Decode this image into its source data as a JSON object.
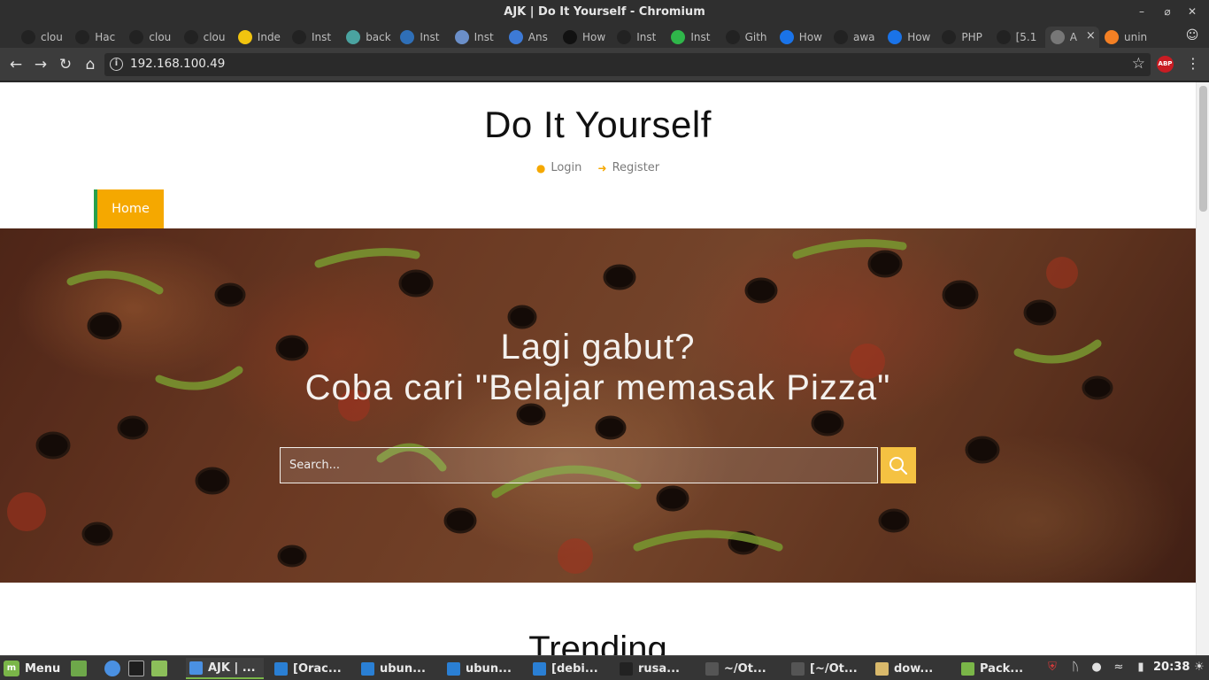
{
  "window": {
    "title": "AJK | Do It Yourself - Chromium"
  },
  "tabs": [
    {
      "label": "clou",
      "icon": "github-icon",
      "color": "#222222"
    },
    {
      "label": "Hac",
      "icon": "github-icon",
      "color": "#222222"
    },
    {
      "label": "clou",
      "icon": "github-icon",
      "color": "#222222"
    },
    {
      "label": "clou",
      "icon": "github-icon",
      "color": "#222222"
    },
    {
      "label": "Inde",
      "icon": "lp-icon",
      "color": "#f1c40f"
    },
    {
      "label": "Inst",
      "icon": "github-icon",
      "color": "#222222"
    },
    {
      "label": "back",
      "icon": "shield-icon",
      "color": "#4aa3a0"
    },
    {
      "label": "Inst",
      "icon": "cr-icon",
      "color": "#2f6fb7"
    },
    {
      "label": "Inst",
      "icon": "network-icon",
      "color": "#6b8fc9"
    },
    {
      "label": "Ans",
      "icon": "askubuntu-icon",
      "color": "#3d7ad6"
    },
    {
      "label": "How",
      "icon": "medium-icon",
      "color": "#111111"
    },
    {
      "label": "Inst",
      "icon": "github-icon",
      "color": "#222222"
    },
    {
      "label": "Inst",
      "icon": "cube-icon",
      "color": "#2fb64a"
    },
    {
      "label": "Gith",
      "icon": "github-icon",
      "color": "#222222"
    },
    {
      "label": "How",
      "icon": "digitalocean-icon",
      "color": "#1a73e8"
    },
    {
      "label": "awa",
      "icon": "github-icon",
      "color": "#222222"
    },
    {
      "label": "How",
      "icon": "digitalocean-icon",
      "color": "#1a73e8"
    },
    {
      "label": "PHP",
      "icon": "github-icon",
      "color": "#222222"
    },
    {
      "label": "[5.1",
      "icon": "github-icon",
      "color": "#222222"
    },
    {
      "label": "A",
      "icon": "page-icon",
      "color": "#777777",
      "active": true
    },
    {
      "label": "unin",
      "icon": "stackoverflow-icon",
      "color": "#f48024"
    }
  ],
  "toolbar": {
    "url": "192.168.100.49",
    "extension": "ABP"
  },
  "page": {
    "site_title": "Do It Yourself",
    "login": "Login",
    "register": "Register",
    "nav_home": "Home",
    "hero_line1": "Lagi gabut?",
    "hero_line2": "Coba cari \"Belajar memasak Pizza\"",
    "search_placeholder": "Search...",
    "trending": "Trending",
    "colors": {
      "accent": "#f5a800",
      "nav_border": "#27a04c",
      "search_button": "#f5c242"
    }
  },
  "taskbar": {
    "menu_label": "Menu",
    "tasks": [
      {
        "label": "AJK | ...",
        "icon": "chromium-icon",
        "color": "#4a90e2",
        "active": true
      },
      {
        "label": "[Orac...",
        "icon": "virtualbox-icon",
        "color": "#2a7fd4"
      },
      {
        "label": "ubun...",
        "icon": "virtualbox-icon",
        "color": "#2a7fd4"
      },
      {
        "label": "ubun...",
        "icon": "virtualbox-icon",
        "color": "#2a7fd4"
      },
      {
        "label": "[debi...",
        "icon": "virtualbox-icon",
        "color": "#2a7fd4"
      },
      {
        "label": "rusa...",
        "icon": "terminal-icon",
        "color": "#222222"
      },
      {
        "label": "~/Ot...",
        "icon": "sublime-icon",
        "color": "#555555"
      },
      {
        "label": "[~/Ot...",
        "icon": "sublime-icon",
        "color": "#555555"
      },
      {
        "label": "dow...",
        "icon": "document-icon",
        "color": "#d9b96b"
      },
      {
        "label": "Pack...",
        "icon": "package-icon",
        "color": "#7ab648"
      }
    ],
    "clock": "20:38"
  }
}
